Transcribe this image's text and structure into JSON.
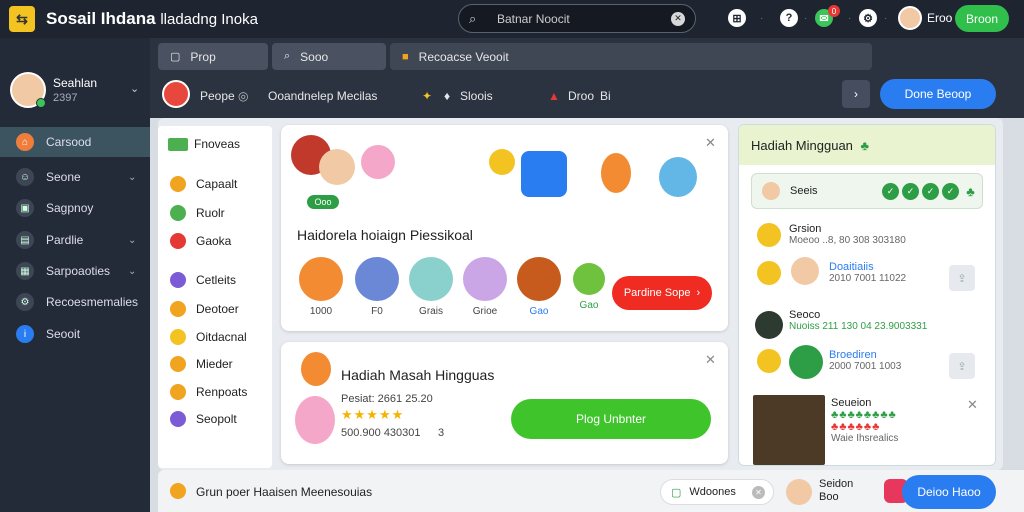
{
  "app": {
    "title": "Sosail Ihdana",
    "subtitle": "lladadng Inoka"
  },
  "search": {
    "text": "Batnar Noocit",
    "icon": "search-icon"
  },
  "topbar": {
    "notif_count": "0",
    "user_label": "Eroo",
    "action_label": "Broon"
  },
  "sidebar": {
    "profile": {
      "name": "Seahlan",
      "meta": "2397"
    },
    "items": [
      {
        "label": "Carsood",
        "icon": "home-icon",
        "active": true
      },
      {
        "label": "Seone",
        "icon": "user-icon",
        "chevron": true
      },
      {
        "label": "Sagpnoy",
        "icon": "image-icon"
      },
      {
        "label": "Pardlie",
        "icon": "folder-icon",
        "chevron": true
      },
      {
        "label": "Sarpoaoties",
        "icon": "grid-icon",
        "chevron": true
      },
      {
        "label": "Recoesmemalies",
        "icon": "gear-icon"
      },
      {
        "label": "Seooit",
        "icon": "info-icon"
      }
    ]
  },
  "tabs": [
    {
      "label": "Prop",
      "icon": "page-icon"
    },
    {
      "label": "Sooo",
      "icon": "search-icon"
    },
    {
      "label": "Recoacse Veooit",
      "icon": "flag-icon"
    }
  ],
  "infobar": {
    "name": "Peope",
    "desc": "Ooandnelep Mecilas",
    "item2": "Sloois",
    "item3": "Droo",
    "item3_suffix": "Bi",
    "primary_button": "Done Beoop"
  },
  "categories": {
    "header": "Fnoveas",
    "items": [
      {
        "label": "Capaalt",
        "color": "#f0a41f"
      },
      {
        "label": "Ruolr",
        "color": "#4caf50"
      },
      {
        "label": "Gaoka",
        "color": "#e53935"
      },
      {
        "label": "Cetleits",
        "color": "#7b5cd6"
      },
      {
        "label": "Deotoer",
        "color": "#f0a41f"
      },
      {
        "label": "Oitdacnal",
        "color": "#f3c321"
      },
      {
        "label": "Mieder",
        "color": "#f0a41f"
      },
      {
        "label": "Renpoats",
        "color": "#f0a41f"
      },
      {
        "label": "Seopolt",
        "color": "#7b5cd6"
      }
    ]
  },
  "featured": {
    "badge": "Ooo",
    "title": "Haidorela hoiaign Piessikoal",
    "friends": [
      {
        "label": "1000",
        "color": "#f28b32"
      },
      {
        "label": "F0",
        "color": "#6a88d6"
      },
      {
        "label": "Grais",
        "color": "#8ad0cc"
      },
      {
        "label": "Grioe",
        "color": "#caa6e6"
      },
      {
        "label": "Gao",
        "color": "#c75a1d"
      },
      {
        "label": "Gao",
        "color": "#6ec23d"
      }
    ],
    "button": "Pardine Sope"
  },
  "weekly": {
    "title": "Hadiah Masah Hingguas",
    "meta1": "Pesiat: 2661 25.20",
    "stars": "★★★★★",
    "meta2": "500.900 430301",
    "meta2_suffix": "3",
    "button": "Plog Unbnter"
  },
  "rightpanel": {
    "title": "Hadiah Mingguan",
    "sub_label": "Seeis",
    "rows": [
      {
        "title": "Grsion",
        "meta": "Moeoo ..8, 80 308 303180"
      },
      {
        "title": "Doaitiaiis",
        "meta": "2010 7001 11022"
      },
      {
        "title": "Seoco",
        "meta": "Nuoiss 211 130 04 23.9003331"
      },
      {
        "title": "Broediren",
        "meta": "2000 7001 1003"
      },
      {
        "title": "Seueion",
        "meta": "Waie Ihsrealics"
      }
    ]
  },
  "bottombar": {
    "text": "Grun poer Haaisen Meenesouias",
    "pill": "Wdoones",
    "user_name": "Seidon",
    "user_meta": "Boo",
    "button": "Deioo Haoo"
  }
}
